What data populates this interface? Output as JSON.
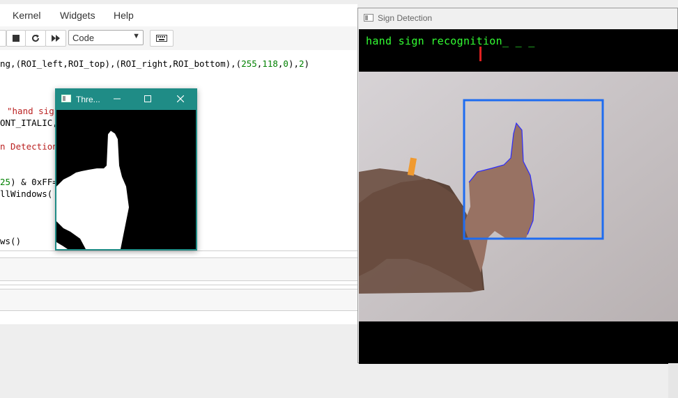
{
  "menu": {
    "kernel": "Kernel",
    "widgets": "Widgets",
    "help": "Help"
  },
  "toolbar": {
    "cell_type": "Code"
  },
  "code": {
    "line1": {
      "a": "ng,(ROI_left,ROI_top),(ROI_right,ROI_bottom),(",
      "n1": "255",
      "c1": ",",
      "n2": "118",
      "c2": ",",
      "n3": "0",
      "c3": "),",
      "n4": "2",
      "c4": ")"
    },
    "line2": "\"hand sig",
    "line3": "ONT_ITALIC,",
    "line4": "n Detection",
    "line5": {
      "n": "25",
      "rest": ") & 0xFF="
    },
    "line6": "llWindows(",
    "line7": "ws()"
  },
  "thresh_window": {
    "title": "Thre..."
  },
  "sign_window": {
    "title": "Sign Detection",
    "overlay": "hand sign recognition_ _ _"
  },
  "colors": {
    "roi_box": "#1e6cf0",
    "overlay_text": "#33ff33",
    "thresh_titlebar": "#1f8c86"
  }
}
